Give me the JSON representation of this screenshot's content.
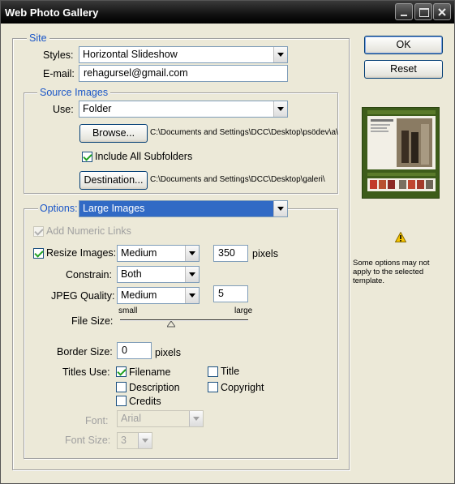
{
  "window": {
    "title": "Web Photo Gallery"
  },
  "site": {
    "legend": "Site",
    "styles_label": "Styles:",
    "styles_value": "Horizontal Slideshow",
    "email_label": "E-mail:",
    "email_value": "rehagursel@gmail.com"
  },
  "source": {
    "legend": "Source Images",
    "use_label": "Use:",
    "use_value": "Folder",
    "browse_label": "Browse...",
    "browse_path": "C:\\Documents and Settings\\DCC\\Desktop\\psödev\\a\\",
    "include_subfolders_label": "Include All Subfolders",
    "include_subfolders_checked": true,
    "destination_label": "Destination...",
    "destination_path": "C:\\Documents and Settings\\DCC\\Desktop\\galeri\\"
  },
  "options": {
    "label": "Options:",
    "value": "Large Images",
    "add_numeric_links_label": "Add Numeric Links",
    "resize_images_label": "Resize Images:",
    "resize_value": "Medium",
    "resize_pixels": "350",
    "pixels_unit": "pixels",
    "constrain_label": "Constrain:",
    "constrain_value": "Both",
    "jpeg_quality_label": "JPEG Quality:",
    "jpeg_quality_value": "Medium",
    "jpeg_quality_number": "5",
    "file_size_label": "File Size:",
    "file_size_min": "small",
    "file_size_max": "large",
    "file_size_position": 0.4,
    "border_size_label": "Border Size:",
    "border_size_value": "0",
    "border_unit": "pixels",
    "titles_use_label": "Titles Use:",
    "titles": {
      "filename": "Filename",
      "title": "Title",
      "description": "Description",
      "copyright": "Copyright",
      "credits": "Credits"
    },
    "font_label": "Font:",
    "font_value": "Arial",
    "font_size_label": "Font Size:",
    "font_size_value": "3"
  },
  "buttons": {
    "ok": "OK",
    "reset": "Reset"
  },
  "warning": {
    "icon": "warning-icon",
    "text": "Some options may not apply to the selected template."
  },
  "colors": {
    "legend": "#1a56c8",
    "highlight": "#316ac5",
    "preview_bg": "#3d5c1a"
  }
}
